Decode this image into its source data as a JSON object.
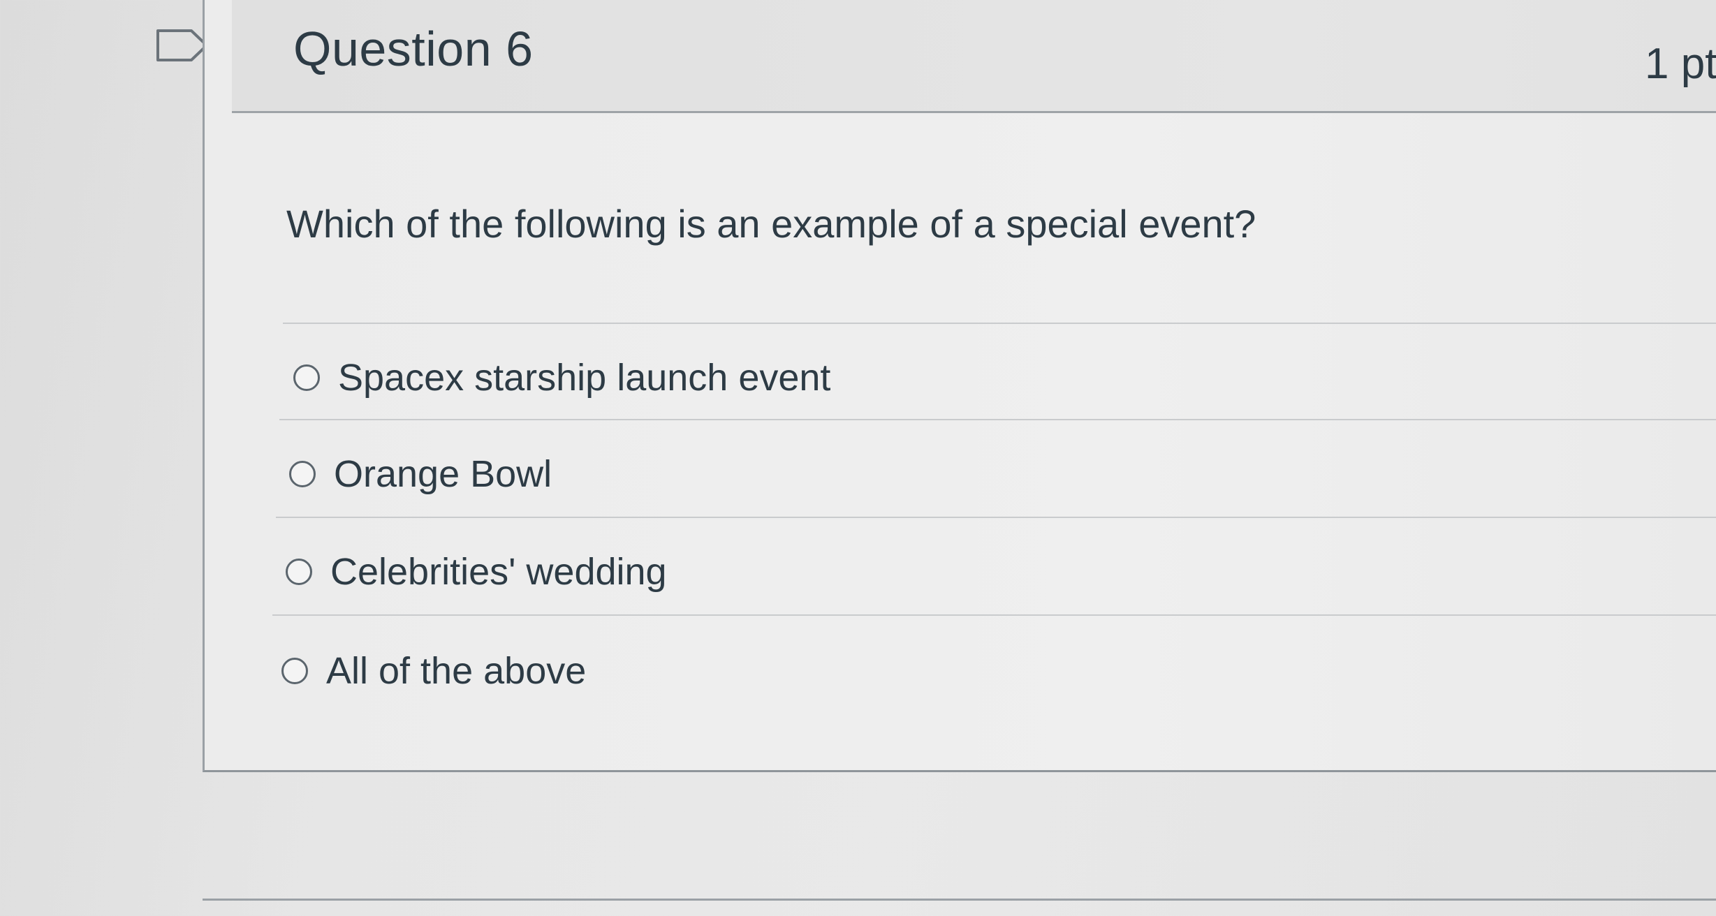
{
  "question": {
    "title": "Question 6",
    "points": "1 pt",
    "text": "Which of the following is an example of a special event?"
  },
  "answers": [
    {
      "label": "Spacex starship launch event"
    },
    {
      "label": "Orange Bowl"
    },
    {
      "label": "Celebrities' wedding"
    },
    {
      "label": "All of the above"
    }
  ],
  "colors": {
    "text": "#2d3b45",
    "border": "#9aa0a5",
    "background": "#e6e6e6"
  },
  "icons": {
    "flag": "flag-outline-icon",
    "radio": "radio-unchecked-icon"
  }
}
